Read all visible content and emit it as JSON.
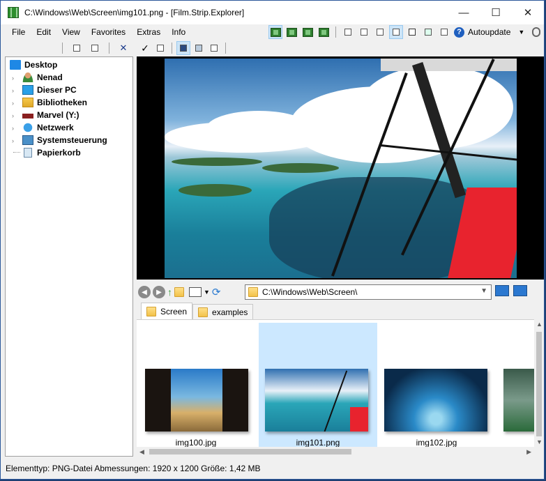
{
  "window": {
    "title": "C:\\Windows\\Web\\Screen\\img101.png - [Film.Strip.Explorer]",
    "minimize": "—",
    "maximize": "☐",
    "close": "✕"
  },
  "menu": {
    "items": [
      "File",
      "Edit",
      "View",
      "Favorites",
      "Extras",
      "Info"
    ],
    "autoupdate": "Autoupdate",
    "help_glyph": "?"
  },
  "tree": {
    "items": [
      {
        "label": "Desktop",
        "icon": "desktop-icon"
      },
      {
        "label": "Nenad",
        "icon": "user-icon"
      },
      {
        "label": "Dieser PC",
        "icon": "computer-icon"
      },
      {
        "label": "Bibliotheken",
        "icon": "libraries-icon"
      },
      {
        "label": "Marvel (Y:)",
        "icon": "network-drive-icon"
      },
      {
        "label": "Netzwerk",
        "icon": "network-icon"
      },
      {
        "label": "Systemsteuerung",
        "icon": "control-panel-icon"
      },
      {
        "label": "Papierkorb",
        "icon": "recycle-bin-icon"
      }
    ]
  },
  "navigation": {
    "path": "C:\\Windows\\Web\\Screen\\"
  },
  "tabs": [
    {
      "label": "Screen",
      "active": true
    },
    {
      "label": "examples",
      "active": false
    }
  ],
  "thumbnails": [
    {
      "label": "img100.jpg",
      "selected": false
    },
    {
      "label": "img101.png",
      "selected": true
    },
    {
      "label": "img102.jpg",
      "selected": false
    }
  ],
  "status": {
    "text": "Elementtyp: PNG-Datei Abmessungen: 1920 x 1200 Größe: 1,42 MB"
  },
  "colors": {
    "accent": "#2b579a",
    "selection": "#cce8ff"
  }
}
